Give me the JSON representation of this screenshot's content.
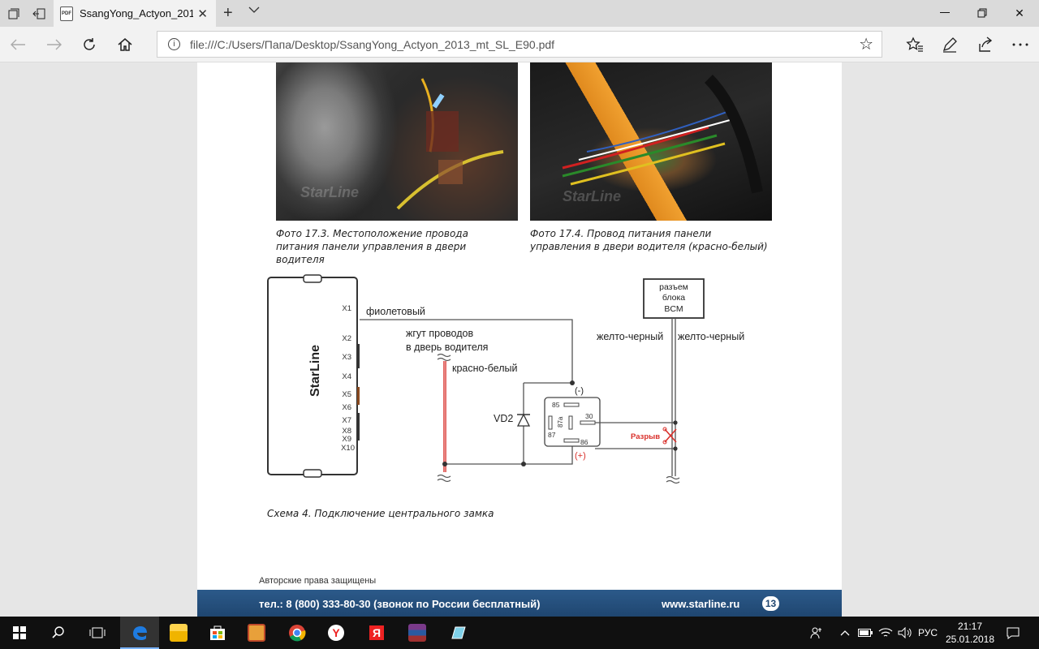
{
  "browser": {
    "tab_title": "SsangYong_Actyon_201",
    "tab_icon_label": "PDF",
    "url": "file:///C:/Users/Папа/Desktop/SsangYong_Actyon_2013_mt_SL_E90.pdf"
  },
  "document": {
    "photo1_caption": "Фото 17.3. Местоположение провода питания панели управления в двери водителя",
    "photo2_caption": "Фото 17.4. Провод питания панели управления в двери водителя (красно-белый)",
    "photo_watermark": "StarLine",
    "schema_caption": "Схема 4. Подключение центрального замка",
    "copyright": "Авторские права защищены",
    "footer_phone": "тел.: 8 (800) 333-80-30 (звонок по России бесплатный)",
    "footer_site": "www.starline.ru",
    "page_number": "13"
  },
  "diagram": {
    "unit_brand": "StarLine",
    "pins": [
      "X1",
      "X2",
      "X3",
      "X4",
      "X5",
      "X6",
      "X7",
      "X8",
      "X9",
      "X10"
    ],
    "wire_violet": "фиолетовый",
    "harness_line1": "жгут проводов",
    "harness_line2": "в дверь водителя",
    "wire_red_white": "красно-белый",
    "bcm_line1": "разъем",
    "bcm_line2": "блока",
    "bcm_line3": "BCM",
    "wire_yb_left": "желто-черный",
    "wire_yb_right": "желто-черный",
    "diode": "VD2",
    "minus": "(-)",
    "plus": "(+)",
    "relay_85": "85",
    "relay_87a": "87a",
    "relay_87": "87",
    "relay_30": "30",
    "relay_86": "86",
    "break_label": "Разрыв"
  },
  "taskbar": {
    "lang": "РУС",
    "time": "21:17",
    "date": "25.01.2018"
  },
  "colors": {
    "footer_blue": "#1f4670",
    "red_wire": "#d9302b",
    "taskbar": "#101010",
    "edge_blue": "#1e7be0"
  }
}
